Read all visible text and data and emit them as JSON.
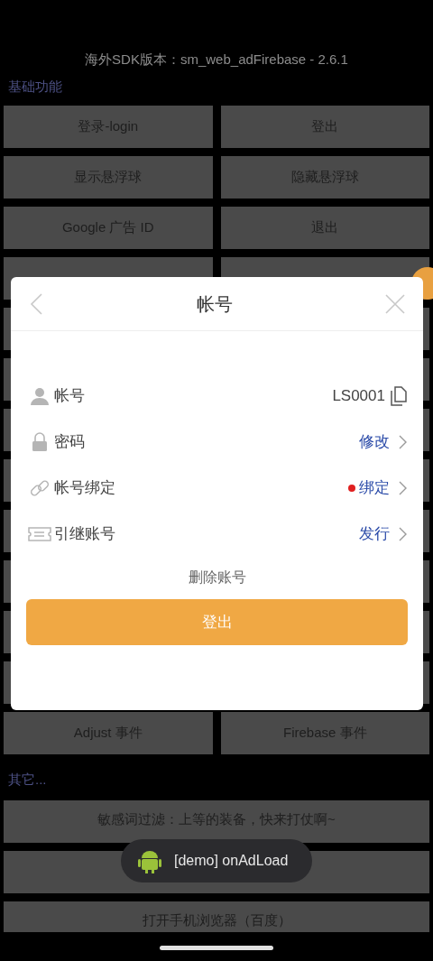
{
  "header": {
    "version": "海外SDK版本：sm_web_adFirebase - 2.6.1"
  },
  "basic": {
    "title": "基础功能",
    "buttons_top": [
      {
        "label": "登录-login"
      },
      {
        "label": "登出"
      },
      {
        "label": "显示悬浮球"
      },
      {
        "label": "隐藏悬浮球"
      },
      {
        "label": "Google 广告 ID"
      },
      {
        "label": "退出"
      }
    ],
    "buttons_bottom": [
      {
        "label": "Adjust 事件"
      },
      {
        "label": "Firebase 事件"
      }
    ]
  },
  "other": {
    "title": "其它...",
    "buttons": [
      {
        "kind": "text",
        "label": "敏感词过滤：上等的装备，快来打仗啊~"
      },
      {
        "kind": "covered"
      },
      {
        "kind": "text",
        "label": "打开手机浏览器（百度）"
      }
    ]
  },
  "dialog": {
    "title": "帐号",
    "rows": [
      {
        "kind": "copy",
        "label": "帐号",
        "value": "LS0001"
      },
      {
        "kind": "link",
        "label": "密码",
        "value": "修改",
        "badge": false
      },
      {
        "kind": "link",
        "label": "帐号绑定",
        "value": "绑定",
        "badge": true
      },
      {
        "kind": "link",
        "label": "引继账号",
        "value": "发行",
        "badge": false
      }
    ],
    "delete": "删除账号",
    "logout": "登出"
  },
  "toast": {
    "text": "[demo] onAdLoad"
  }
}
